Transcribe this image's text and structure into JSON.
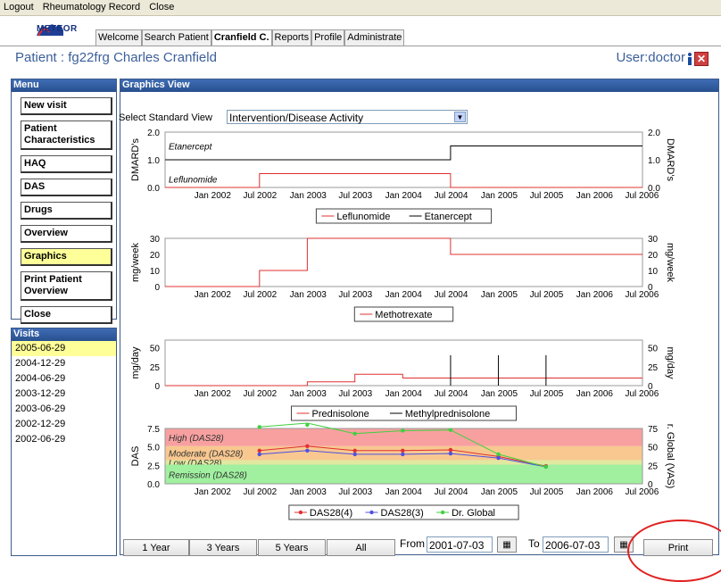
{
  "menubar": [
    "Logout",
    "Rheumatology Record",
    "Close"
  ],
  "brand": "METEOR",
  "tabs": [
    {
      "label": "Welcome",
      "active": false
    },
    {
      "label": "Search Patient",
      "active": false
    },
    {
      "label": "Cranfield C.",
      "active": true
    },
    {
      "label": "Reports",
      "active": false
    },
    {
      "label": "Profile",
      "active": false
    },
    {
      "label": "Administrate",
      "active": false
    }
  ],
  "patient_label": "Patient : fg22frg Charles Cranfield",
  "user_label": "User:doctor",
  "menu": {
    "title": "Menu",
    "items": [
      "New visit",
      "Patient Characteristics",
      "HAQ",
      "DAS",
      "Drugs",
      "Overview",
      "Graphics",
      "Print Patient Overview",
      "Close"
    ],
    "selected": "Graphics"
  },
  "visits": {
    "title": "Visits",
    "items": [
      "2005-06-29",
      "2004-12-29",
      "2004-06-29",
      "2003-12-29",
      "2003-06-29",
      "2002-12-29",
      "2002-06-29"
    ],
    "selected": "2005-06-29"
  },
  "graphics": {
    "title": "Graphics View",
    "select_label": "Select Standard View",
    "select_value": "Intervention/Disease Activity"
  },
  "footer": {
    "range_buttons": [
      "1 Year",
      "3 Years",
      "5 Years",
      "All"
    ],
    "from_label": "From",
    "from_value": "2001-07-03",
    "to_label": "To",
    "to_value": "2006-07-03",
    "print_label": "Print"
  },
  "colors": {
    "accent": "#3c5a8a",
    "highlight": "#ffff99",
    "red_series": "#e03030",
    "blue_series": "#5050e0",
    "green_series": "#40d040"
  },
  "chart_data": [
    {
      "type": "line",
      "ylabel": "DMARD's",
      "ylim": [
        0,
        2
      ],
      "yticks": [
        "0.0",
        "1.0",
        "2.0"
      ],
      "xticks": [
        "Jan 2002",
        "Jul 2002",
        "Jan 2003",
        "Jul 2003",
        "Jan 2004",
        "Jul 2004",
        "Jan 2005",
        "Jul 2005",
        "Jan 2006",
        "Jul 2006"
      ],
      "annotations": [
        "Etanercept",
        "Leflunomide"
      ],
      "series": [
        {
          "name": "Leflunomide",
          "color": "#e03030",
          "points": [
            [
              "2001-07-03",
              0
            ],
            [
              "2002-06-29",
              0
            ],
            [
              "2002-06-29",
              0.5
            ],
            [
              "2004-06-29",
              0.5
            ],
            [
              "2004-06-29",
              0
            ],
            [
              "2006-07-03",
              0
            ]
          ]
        },
        {
          "name": "Etanercept",
          "color": "#000000",
          "points": [
            [
              "2001-07-03",
              1
            ],
            [
              "2004-06-29",
              1
            ],
            [
              "2004-06-29",
              1.5
            ],
            [
              "2006-07-03",
              1.5
            ]
          ]
        }
      ]
    },
    {
      "type": "line",
      "ylabel": "mg/week",
      "ylim": [
        0,
        30
      ],
      "yticks": [
        "0",
        "10",
        "20",
        "30"
      ],
      "xticks": [
        "Jan 2002",
        "Jul 2002",
        "Jan 2003",
        "Jul 2003",
        "Jan 2004",
        "Jul 2004",
        "Jan 2005",
        "Jul 2005",
        "Jan 2006",
        "Jul 2006"
      ],
      "series": [
        {
          "name": "Methotrexate",
          "color": "#e03030",
          "points": [
            [
              "2001-07-03",
              0
            ],
            [
              "2002-06-29",
              0
            ],
            [
              "2002-06-29",
              10
            ],
            [
              "2002-12-29",
              10
            ],
            [
              "2002-12-29",
              30
            ],
            [
              "2004-06-29",
              30
            ],
            [
              "2004-06-29",
              20
            ],
            [
              "2006-07-03",
              20
            ]
          ]
        }
      ]
    },
    {
      "type": "line",
      "ylabel": "mg/day",
      "ylim": [
        0,
        60
      ],
      "yticks": [
        "0",
        "25",
        "50"
      ],
      "xticks": [
        "Jan 2002",
        "Jul 2002",
        "Jan 2003",
        "Jul 2003",
        "Jan 2004",
        "Jul 2004",
        "Jan 2005",
        "Jul 2005",
        "Jan 2006",
        "Jul 2006"
      ],
      "series": [
        {
          "name": "Prednisolone",
          "color": "#e03030",
          "points": [
            [
              "2001-07-03",
              0
            ],
            [
              "2002-12-29",
              0
            ],
            [
              "2002-12-29",
              5
            ],
            [
              "2003-06-29",
              5
            ],
            [
              "2003-06-29",
              15
            ],
            [
              "2003-12-29",
              15
            ],
            [
              "2003-12-29",
              10
            ],
            [
              "2006-07-03",
              10
            ]
          ]
        },
        {
          "name": "Methylprednisolone",
          "color": "#000000",
          "spikes": [
            [
              "2004-06-29",
              40
            ],
            [
              "2004-12-29",
              40
            ],
            [
              "2005-06-29",
              40
            ]
          ]
        }
      ]
    },
    {
      "type": "line",
      "ylabel": "DAS",
      "ylabel_right": "r. Global (VAS)",
      "ylim": [
        0,
        7.5
      ],
      "yticks": [
        "0.0",
        "2.5",
        "5.0",
        "7.5"
      ],
      "yticks_right": [
        "0",
        "25",
        "50",
        "75"
      ],
      "xticks": [
        "Jan 2002",
        "Jul 2002",
        "Jan 2003",
        "Jul 2003",
        "Jan 2004",
        "Jul 2004",
        "Jan 2005",
        "Jul 2005",
        "Jan 2006",
        "Jul 2006"
      ],
      "bands": [
        {
          "label": "High (DAS28)",
          "from": 5.1,
          "to": 7.5,
          "color": "#f8a0a0"
        },
        {
          "label": "Moderate (DAS28)",
          "from": 3.2,
          "to": 5.1,
          "color": "#f8c890"
        },
        {
          "label": "Low (DAS28)",
          "from": 2.6,
          "to": 3.2,
          "color": "#e0e8a0"
        },
        {
          "label": "Remission (DAS28)",
          "from": 0,
          "to": 2.6,
          "color": "#a0f0a0"
        }
      ],
      "series": [
        {
          "name": "DAS28(4)",
          "color": "#e03030",
          "points": [
            [
              "2002-06-29",
              4.5
            ],
            [
              "2002-12-29",
              5.1
            ],
            [
              "2003-06-29",
              4.5
            ],
            [
              "2003-12-29",
              4.5
            ],
            [
              "2004-06-29",
              4.6
            ],
            [
              "2004-12-29",
              3.7
            ],
            [
              "2005-06-29",
              2.4
            ]
          ]
        },
        {
          "name": "DAS28(3)",
          "color": "#5050e0",
          "points": [
            [
              "2002-06-29",
              4.0
            ],
            [
              "2002-12-29",
              4.5
            ],
            [
              "2003-06-29",
              4.0
            ],
            [
              "2003-12-29",
              4.0
            ],
            [
              "2004-06-29",
              4.1
            ],
            [
              "2004-12-29",
              3.5
            ],
            [
              "2005-06-29",
              2.3
            ]
          ]
        },
        {
          "name": "Dr. Global",
          "color": "#40d040",
          "axis": "right",
          "points": [
            [
              "2002-06-29",
              77
            ],
            [
              "2002-12-29",
              86
            ],
            [
              "2003-06-29",
              68
            ],
            [
              "2003-12-29",
              72
            ],
            [
              "2004-06-29",
              73
            ],
            [
              "2004-12-29",
              40
            ],
            [
              "2005-06-29",
              23
            ]
          ]
        }
      ]
    }
  ]
}
